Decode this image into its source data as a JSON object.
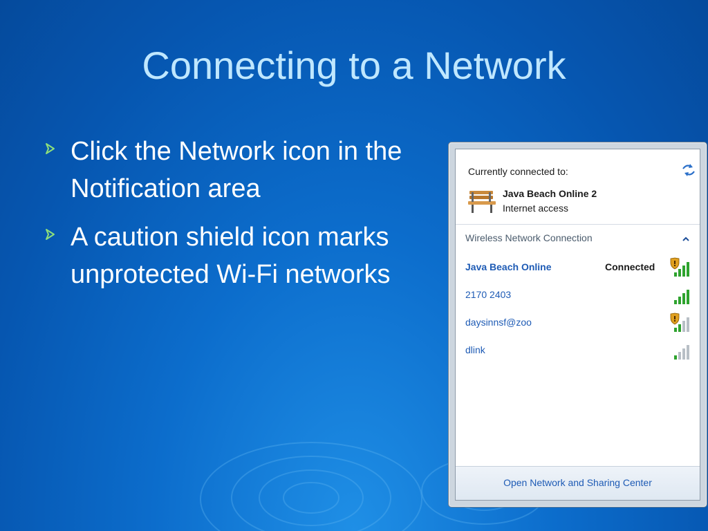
{
  "slide": {
    "title": "Connecting to a Network",
    "bullets": [
      "Click the Network icon in the Notification area",
      "A caution shield icon marks unprotected Wi-Fi networks"
    ]
  },
  "flyout": {
    "currently_connected_label": "Currently connected to:",
    "current": {
      "name": "Java Beach Online  2",
      "status": "Internet access"
    },
    "section_header": "Wireless Network Connection",
    "networks": [
      {
        "name": "Java Beach Online",
        "status": "Connected",
        "secured": false
      },
      {
        "name": "2170 2403",
        "status": "",
        "secured": true
      },
      {
        "name": "daysinnsf@zoo",
        "status": "",
        "secured": false
      },
      {
        "name": "dlink",
        "status": "",
        "secured": true
      }
    ],
    "footer_link": "Open Network and Sharing Center"
  },
  "colors": {
    "title": "#bfe7ff",
    "bullet_arrow": "#8fe07a",
    "link": "#1e5bb5",
    "signal_green": "#2ea32e",
    "shield": "#e0a020"
  },
  "icons": [
    "refresh-icon",
    "bench-icon",
    "collapse-icon",
    "signal-icon",
    "shield-icon",
    "bullet-arrow-icon"
  ]
}
